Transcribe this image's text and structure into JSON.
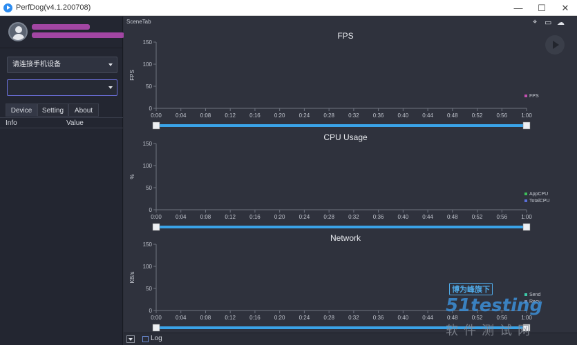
{
  "window": {
    "title": "PerfDog(v4.1.200708)",
    "controls": {
      "minimize": "—",
      "maximize": "☐",
      "close": "✕"
    }
  },
  "sidebar": {
    "device_select": {
      "value": "请连接手机设备"
    },
    "app_select": {
      "value": ""
    },
    "tabs": [
      {
        "label": "Device",
        "active": true
      },
      {
        "label": "Setting",
        "active": false
      },
      {
        "label": "About",
        "active": false
      }
    ],
    "info_table": {
      "columns": [
        "Info",
        "Value"
      ]
    }
  },
  "main": {
    "scene_tab_label": "SceneTab",
    "top_icons": [
      "location-icon",
      "folder-icon",
      "cloud-icon"
    ]
  },
  "bottom_bar": {
    "log_label": "Log"
  },
  "watermark": {
    "badge": "博为峰旗下",
    "brand": "51testing",
    "sub": "软件测试网"
  },
  "chart_data": [
    {
      "type": "line",
      "title": "FPS",
      "ylabel": "FPS",
      "ylim": [
        0,
        150
      ],
      "yticks": [
        0,
        50,
        100,
        150
      ],
      "xticks": [
        "0:00",
        "0:04",
        "0:08",
        "0:12",
        "0:16",
        "0:20",
        "0:24",
        "0:28",
        "0:32",
        "0:36",
        "0:40",
        "0:44",
        "0:48",
        "0:52",
        "0:56",
        "1:00"
      ],
      "series": [
        {
          "name": "FPS",
          "color": "#c24fb0",
          "values": []
        }
      ],
      "legend": "right"
    },
    {
      "type": "line",
      "title": "CPU Usage",
      "ylabel": "%",
      "ylim": [
        0,
        150
      ],
      "yticks": [
        0,
        50,
        100,
        150
      ],
      "xticks": [
        "0:00",
        "0:04",
        "0:08",
        "0:12",
        "0:16",
        "0:20",
        "0:24",
        "0:28",
        "0:32",
        "0:36",
        "0:40",
        "0:44",
        "0:48",
        "0:52",
        "0:56",
        "1:00"
      ],
      "series": [
        {
          "name": "AppCPU",
          "color": "#3dbf5a",
          "values": []
        },
        {
          "name": "TotalCPU",
          "color": "#5a6fd8",
          "values": []
        }
      ],
      "legend": "right"
    },
    {
      "type": "line",
      "title": "Network",
      "ylabel": "KB/s",
      "ylim": [
        0,
        150
      ],
      "yticks": [
        0,
        50,
        100,
        150
      ],
      "xticks": [
        "0:00",
        "0:04",
        "0:08",
        "0:12",
        "0:16",
        "0:20",
        "0:24",
        "0:28",
        "0:32",
        "0:36",
        "0:40",
        "0:44",
        "0:48",
        "0:52",
        "0:56",
        "1:00"
      ],
      "series": [
        {
          "name": "Send",
          "color": "#3dc9a8",
          "values": []
        },
        {
          "name": "Recv",
          "color": "#7a86a8",
          "values": []
        }
      ],
      "legend": "right"
    }
  ]
}
